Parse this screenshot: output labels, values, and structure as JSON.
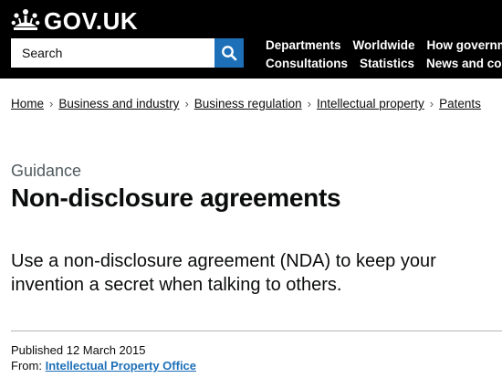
{
  "header": {
    "logo_text": "GOV.UK",
    "search_placeholder": "Search",
    "nav_row1": [
      "Departments",
      "Worldwide",
      "How government works"
    ],
    "nav_row2": [
      "Consultations",
      "Statistics",
      "News and communications"
    ]
  },
  "breadcrumbs": [
    "Home",
    "Business and industry",
    "Business regulation",
    "Intellectual property",
    "Patents"
  ],
  "page": {
    "caption": "Guidance",
    "title": "Non-disclosure agreements",
    "lead": "Use a non-disclosure agreement (NDA) to keep your invention a secret when talking to others.",
    "published_label": "Published",
    "published_date": "12 March 2015",
    "from_label": "From:",
    "from_org": "Intellectual Property Office"
  },
  "colors": {
    "header_bg": "#000000",
    "search_button": "#1d70b8",
    "link": "#1d70b8"
  },
  "icons": {
    "logo": "crown-icon",
    "search": "search-icon",
    "breadcrumb_separator": "chevron-right-icon"
  }
}
